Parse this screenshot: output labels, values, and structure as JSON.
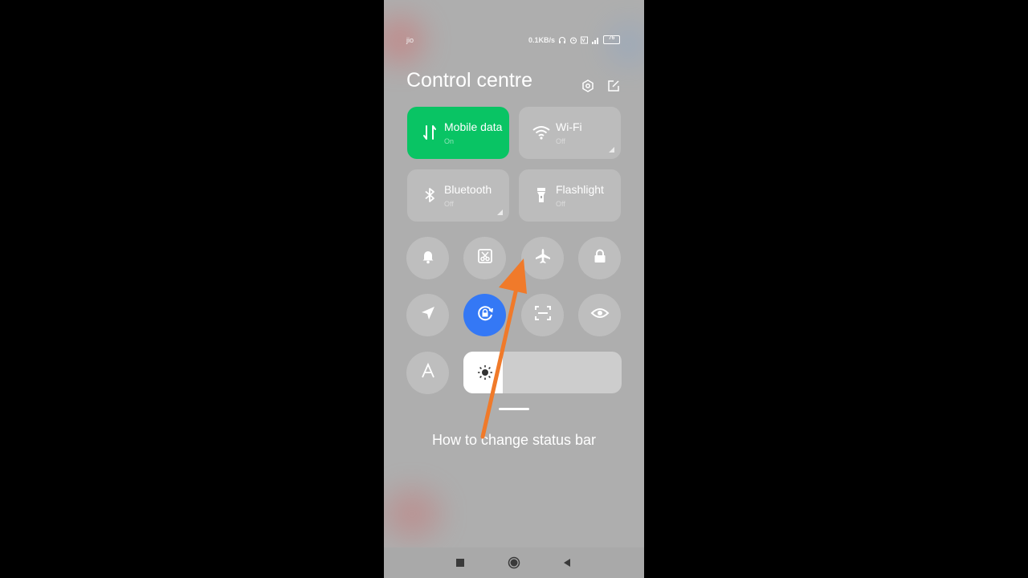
{
  "status_bar": {
    "carrier": "jio",
    "speed": "0.1KB/s",
    "battery": "76",
    "icons": [
      "headphones-icon",
      "alarm-icon",
      "volte-icon",
      "signal-icon",
      "battery-icon"
    ]
  },
  "header": {
    "title": "Control centre",
    "icons": [
      "settings-icon",
      "edit-icon"
    ]
  },
  "tiles": [
    {
      "name": "Mobile data",
      "state": "On",
      "icon": "mobile-data-icon",
      "active": true
    },
    {
      "name": "Wi-Fi",
      "state": "Off",
      "icon": "wifi-icon",
      "active": false
    },
    {
      "name": "Bluetooth",
      "state": "Off",
      "icon": "bluetooth-icon",
      "active": false
    },
    {
      "name": "Flashlight",
      "state": "Off",
      "icon": "flashlight-icon",
      "active": false
    }
  ],
  "round_buttons": [
    {
      "icon": "bell-icon",
      "active": false
    },
    {
      "icon": "screenshot-icon",
      "active": false
    },
    {
      "icon": "airplane-icon",
      "active": false
    },
    {
      "icon": "lock-icon",
      "active": false
    },
    {
      "icon": "location-icon",
      "active": false
    },
    {
      "icon": "rotation-lock-icon",
      "active": true
    },
    {
      "icon": "scan-icon",
      "active": false
    },
    {
      "icon": "eye-icon",
      "active": false
    },
    {
      "icon": "auto-brightness-icon",
      "active": false
    }
  ],
  "brightness": {
    "level": 0.25,
    "icon": "sun-icon"
  },
  "caption": "How to change status bar",
  "nav": [
    "recents-icon",
    "home-icon",
    "back-icon"
  ],
  "colors": {
    "accent_green": "#09c464",
    "accent_blue": "#3478f5",
    "arrow": "#f07a2a"
  }
}
